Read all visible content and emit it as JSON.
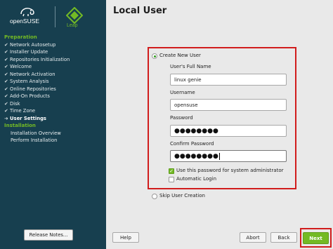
{
  "brand": {
    "name_part1": "open",
    "name_part2": "SUSE",
    "edition": "Leap"
  },
  "sidebar": {
    "sections": [
      {
        "title": "Preparation",
        "steps": [
          {
            "label": "Network Autosetup",
            "state": "done"
          },
          {
            "label": "Installer Update",
            "state": "done"
          },
          {
            "label": "Repositories Initialization",
            "state": "done"
          },
          {
            "label": "Welcome",
            "state": "done"
          },
          {
            "label": "Network Activation",
            "state": "done"
          },
          {
            "label": "System Analysis",
            "state": "done"
          },
          {
            "label": "Online Repositories",
            "state": "done"
          },
          {
            "label": "Add-On Products",
            "state": "done"
          },
          {
            "label": "Disk",
            "state": "done"
          },
          {
            "label": "Time Zone",
            "state": "done"
          },
          {
            "label": "User Settings",
            "state": "current"
          }
        ]
      },
      {
        "title": "Installation",
        "steps": [
          {
            "label": "Installation Overview",
            "state": "pending"
          },
          {
            "label": "Perform Installation",
            "state": "pending"
          }
        ]
      }
    ],
    "release_notes_label": "Release Notes...",
    "marks": {
      "done": "✔",
      "current": "➜"
    }
  },
  "page": {
    "title": "Local User"
  },
  "form": {
    "create_new_user_label": "Create New User",
    "full_name_label": "User's Full Name",
    "full_name_value": "linux genie",
    "username_label": "Username",
    "username_value": "opensuse",
    "password_label": "Password",
    "password_value": "●●●●●●●●",
    "confirm_password_label": "Confirm Password",
    "confirm_password_value": "●●●●●●●●",
    "use_for_admin_label": "Use this password for system administrator",
    "use_for_admin_checked": true,
    "automatic_login_label": "Automatic Login",
    "automatic_login_checked": false,
    "skip_user_creation_label": "Skip User Creation"
  },
  "footer": {
    "help_label": "Help",
    "abort_label": "Abort",
    "back_label": "Back",
    "next_label": "Next"
  },
  "colors": {
    "sidebar_bg": "#173f4f",
    "accent_green": "#73ba25",
    "highlight_red": "#d11c1c"
  }
}
